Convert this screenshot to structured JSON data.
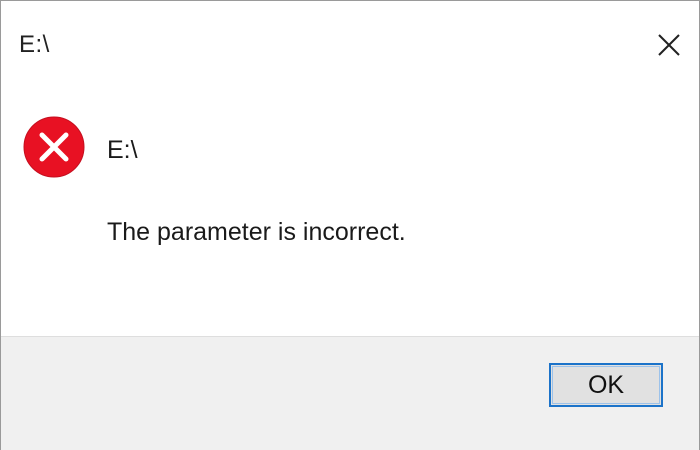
{
  "window": {
    "title": "E:\\",
    "close_icon": "close-icon"
  },
  "message": {
    "icon": "error-icon",
    "heading": "E:\\",
    "body": "The parameter is incorrect."
  },
  "footer": {
    "ok_label": "OK"
  },
  "colors": {
    "error_red": "#e81123",
    "accent_border": "#1c73c9",
    "footer_bg": "#f0f0f0"
  }
}
